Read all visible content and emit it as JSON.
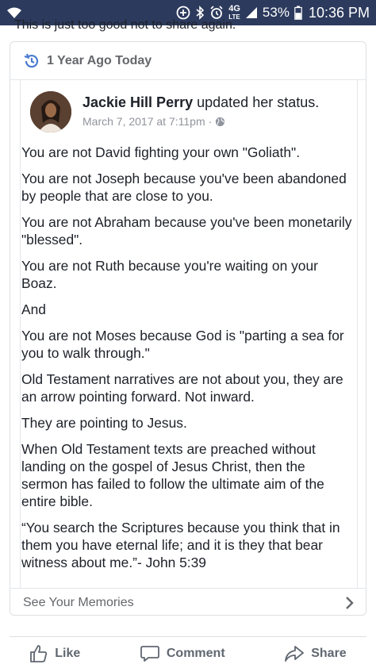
{
  "status_bar": {
    "network": "4G",
    "network_sub": "LTE",
    "battery_percent": "53%",
    "battery_level": 0.53,
    "time": "10:36 PM"
  },
  "post": {
    "truncated_caption": "This is just too good not to share again."
  },
  "memory": {
    "title": "1 Year Ago Today",
    "author_name": "Jackie Hill Perry",
    "author_action": "updated her status.",
    "date": "March 7, 2017 at 7:11pm",
    "privacy": "·",
    "paragraphs": [
      "You are not David fighting your own \"Goliath\".",
      "You are not Joseph because you've been abandoned by people that are close to you.",
      "You are not Abraham because you've been monetarily \"blessed\".",
      "You are not Ruth because you're waiting on your Boaz.",
      "And",
      "You are not Moses because God is \"parting a sea for you to walk through.\"",
      "Old Testament narratives are not about you, they are an arrow pointing forward. Not inward.",
      "They are pointing to Jesus.",
      "When Old Testament texts are preached without landing on the gospel of Jesus Christ, then the sermon has failed to follow the ultimate aim of the entire bible.",
      "“You search the Scriptures because you think that in them you have eternal life; and it is they that bear witness about me.”- John 5:39"
    ],
    "see_memories_label": "See Your Memories"
  },
  "actions": {
    "like": "Like",
    "comment": "Comment",
    "share": "Share"
  },
  "icons": {
    "memory": "history-icon",
    "privacy": "globe-icon",
    "chevron": "chevron-right-icon"
  },
  "colors": {
    "status_bar": "#2c3a5d",
    "memory_accent": "#4a7bd0",
    "text": "#1d2129",
    "muted": "#65676b"
  }
}
